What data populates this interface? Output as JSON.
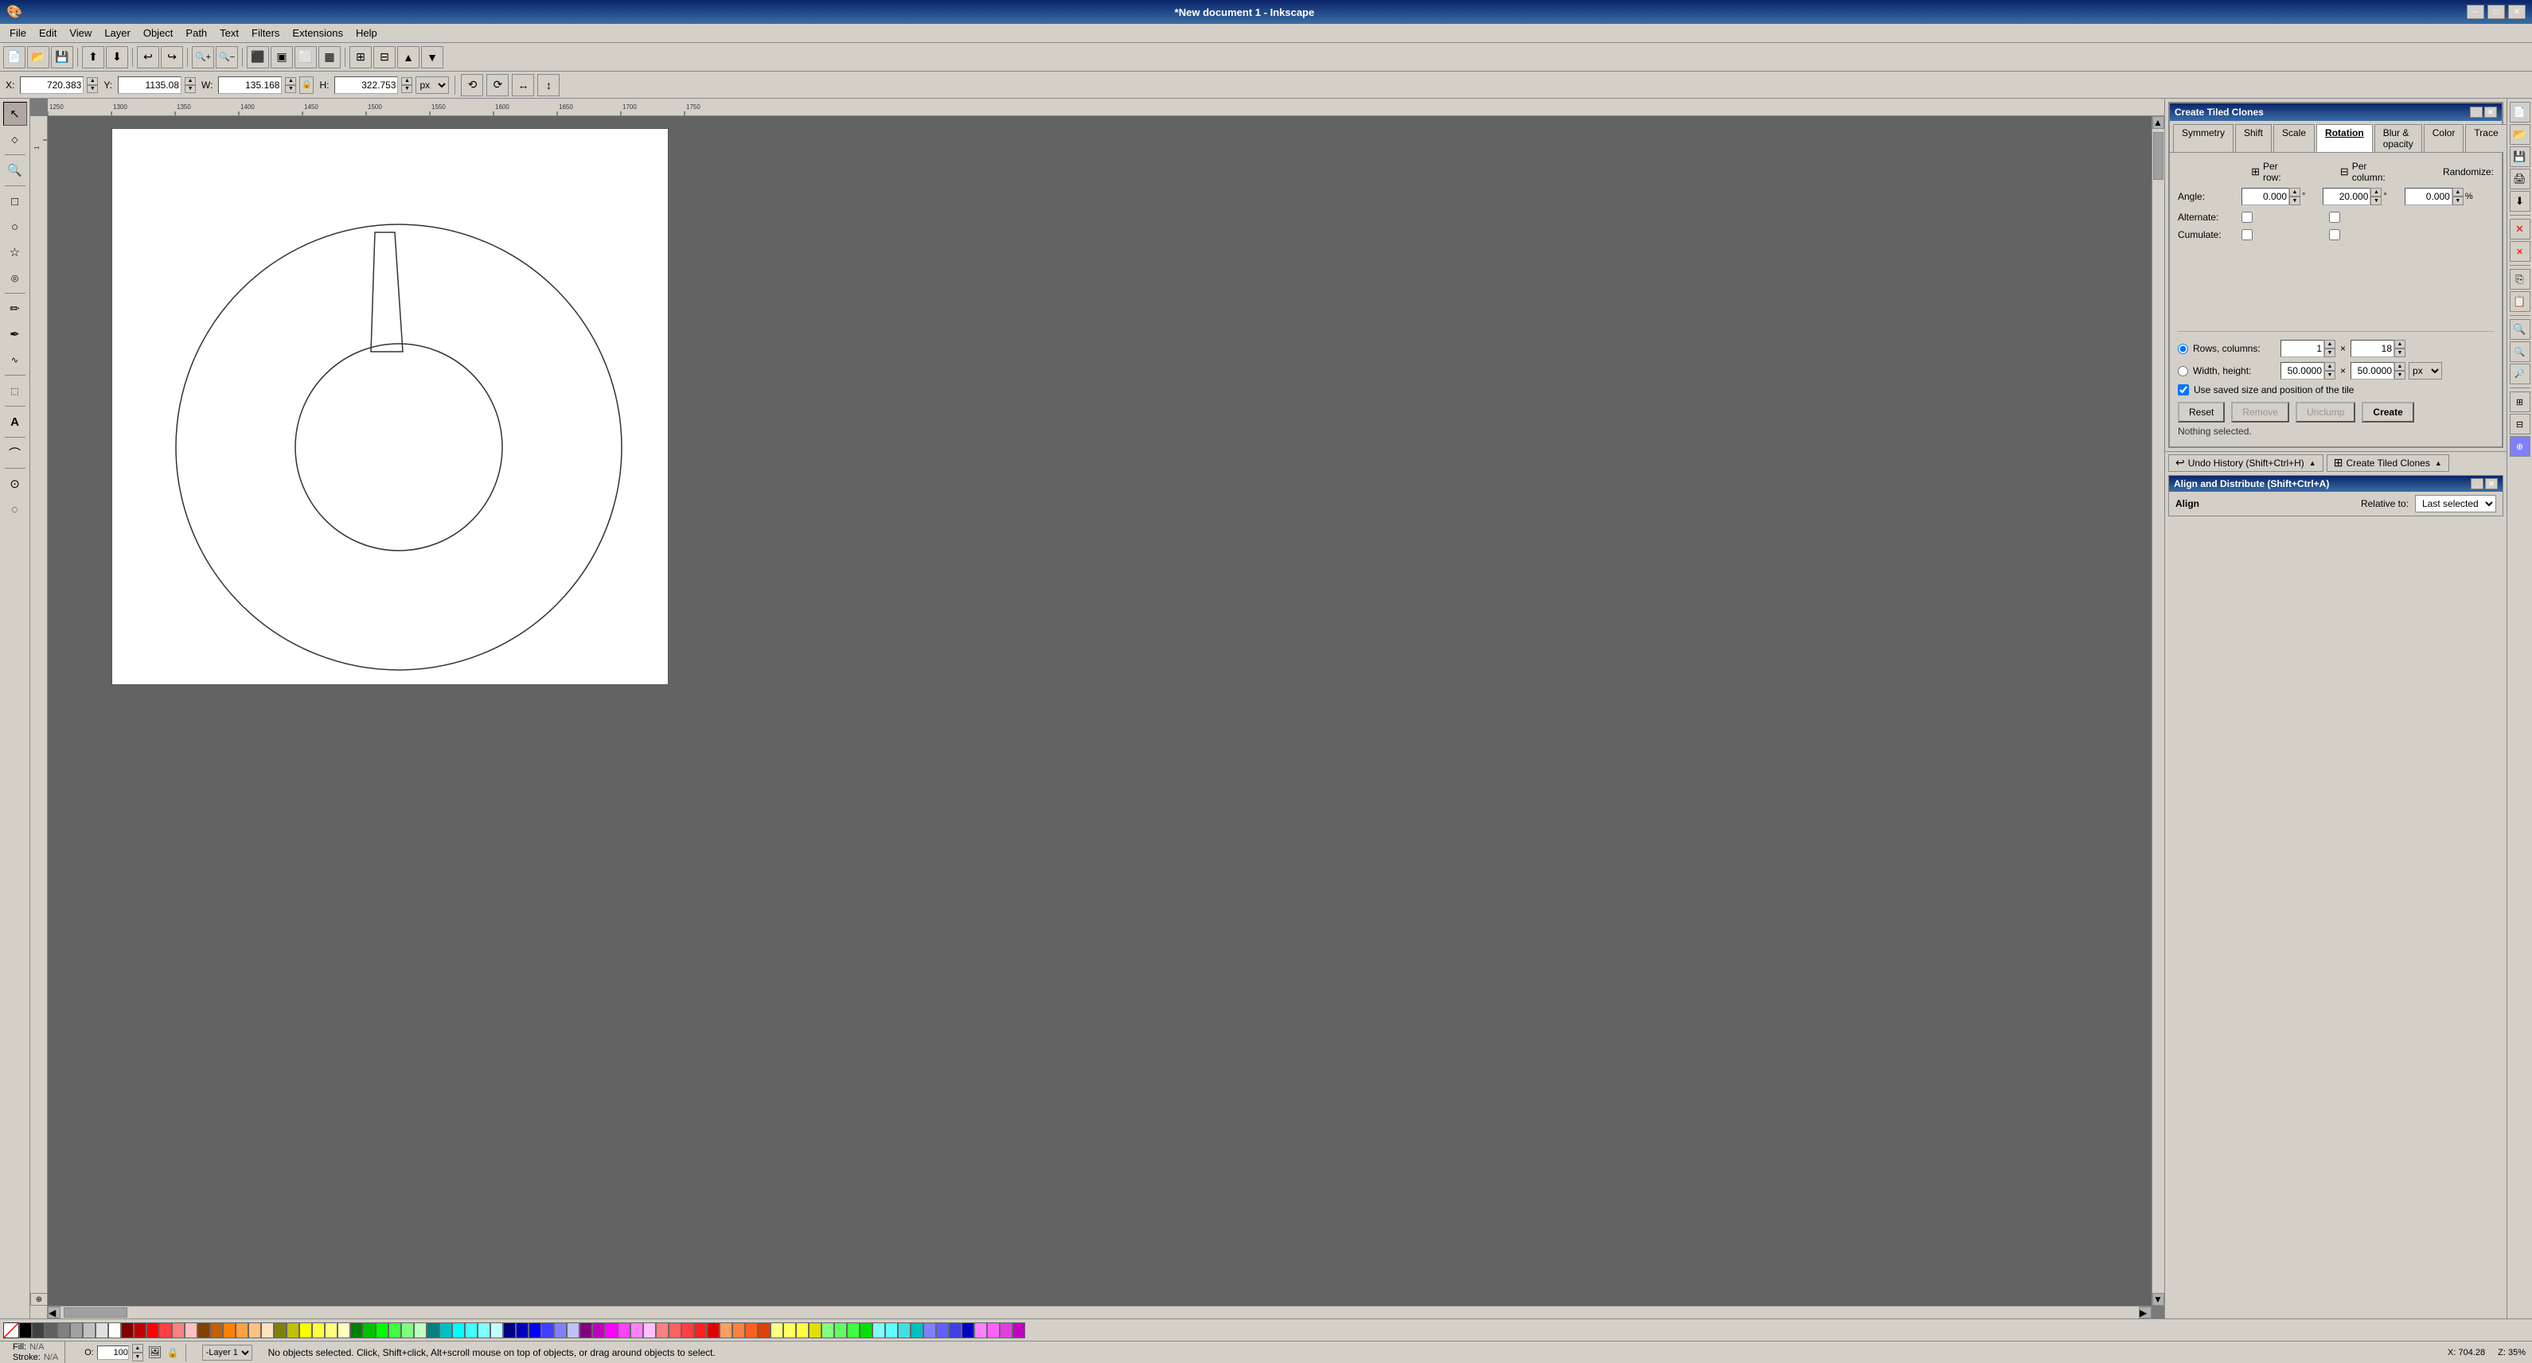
{
  "titlebar": {
    "title": "*New document 1 - Inkscape",
    "minimize": "─",
    "maximize": "□",
    "close": "✕"
  },
  "menu": {
    "items": [
      "File",
      "Edit",
      "View",
      "Layer",
      "Object",
      "Path",
      "Text",
      "Filters",
      "Extensions",
      "Help"
    ]
  },
  "toolbar": {
    "buttons": [
      "new",
      "open",
      "save",
      "print",
      "import",
      "export",
      "undo",
      "redo",
      "zoom-in",
      "zoom-out"
    ]
  },
  "coordbar": {
    "x_label": "X:",
    "x_value": "720.383",
    "y_label": "Y:",
    "y_value": "1135.08",
    "w_label": "W:",
    "w_value": "135.168",
    "h_label": "H:",
    "h_value": "322.753",
    "unit": "px",
    "lock": "🔒"
  },
  "left_tools": {
    "tools": [
      {
        "name": "select",
        "icon": "↖",
        "label": "Select tool"
      },
      {
        "name": "node",
        "icon": "◇",
        "label": "Node tool"
      },
      {
        "name": "zoom",
        "icon": "🔍",
        "label": "Zoom tool"
      },
      {
        "name": "rect",
        "icon": "□",
        "label": "Rectangle tool"
      },
      {
        "name": "ellipse",
        "icon": "○",
        "label": "Ellipse tool"
      },
      {
        "name": "star",
        "icon": "☆",
        "label": "Star tool"
      },
      {
        "name": "spiral",
        "icon": "◎",
        "label": "Spiral tool"
      },
      {
        "name": "pencil",
        "icon": "✏",
        "label": "Pencil tool"
      },
      {
        "name": "pen",
        "icon": "✒",
        "label": "Pen tool"
      },
      {
        "name": "calligraphy",
        "icon": "∿",
        "label": "Calligraphy tool"
      },
      {
        "name": "paint-bucket",
        "icon": "⬚",
        "label": "Paint bucket"
      },
      {
        "name": "text",
        "icon": "A",
        "label": "Text tool"
      },
      {
        "name": "connector",
        "icon": "⌒",
        "label": "Connector tool"
      },
      {
        "name": "dropper",
        "icon": "⊙",
        "label": "Dropper tool"
      },
      {
        "name": "spray",
        "icon": "◌",
        "label": "Spray tool"
      }
    ]
  },
  "tiled_clones": {
    "title": "Create Tiled Clones",
    "tabs": [
      "Symmetry",
      "Shift",
      "Scale",
      "Rotation",
      "Blur & opacity",
      "Color",
      "Trace"
    ],
    "active_tab": "Rotation",
    "headers": {
      "per_row": "Per row:",
      "per_column": "Per column:",
      "randomize": "Randomize:"
    },
    "angle_label": "Angle:",
    "angle_per_row": "0.000",
    "angle_per_col": "20.000",
    "angle_random": "0.000",
    "degree_sym": "°",
    "percent_sym": "%",
    "alternate_label": "Alternate:",
    "cumulate_label": "Cumulate:",
    "rows_cols_label": "Rows, columns:",
    "rows_value": "1",
    "cols_value": "18",
    "width_height_label": "Width, height:",
    "width_value": "50.0000",
    "height_value": "50.0000",
    "unit": "px",
    "use_saved_label": "Use saved size and position of the tile",
    "buttons": {
      "reset": "Reset",
      "remove": "Remove",
      "unclump": "Unclump",
      "create": "Create"
    },
    "status": "Nothing selected."
  },
  "dock": {
    "undo_history": "Undo History (Shift+Ctrl+H)",
    "create_tiled_clones": "Create Tiled Clones"
  },
  "align": {
    "title": "Align and Distribute (Shift+Ctrl+A)",
    "label": "Align",
    "relative_to_label": "Relative to:",
    "relative_to_value": "Last selected"
  },
  "status_bar": {
    "fill_label": "Fill:",
    "fill_value": "N/A",
    "stroke_label": "Stroke:",
    "stroke_value": "N/A",
    "opacity_label": "O:",
    "opacity_value": "100",
    "layer_label": "-Layer 1",
    "message": "No objects selected. Click, Shift+click, Alt+scroll mouse on top of objects, or drag around objects to select.",
    "coords": "X: 704.28",
    "zoom": "Z: 35%"
  },
  "palette_colors": [
    "#000000",
    "#404040",
    "#606060",
    "#808080",
    "#a0a0a0",
    "#c0c0c0",
    "#e0e0e0",
    "#ffffff",
    "#800000",
    "#c00000",
    "#ff0000",
    "#ff4040",
    "#ff8080",
    "#ffc0c0",
    "#804000",
    "#c06000",
    "#ff8000",
    "#ffa040",
    "#ffc080",
    "#ffe0c0",
    "#808000",
    "#c0c000",
    "#ffff00",
    "#ffff40",
    "#ffff80",
    "#ffffc0",
    "#008000",
    "#00c000",
    "#00ff00",
    "#40ff40",
    "#80ff80",
    "#c0ffc0",
    "#008080",
    "#00c0c0",
    "#00ffff",
    "#40ffff",
    "#80ffff",
    "#c0ffff",
    "#000080",
    "#0000c0",
    "#0000ff",
    "#4040ff",
    "#8080ff",
    "#c0c0ff",
    "#800080",
    "#c000c0",
    "#ff00ff",
    "#ff40ff",
    "#ff80ff",
    "#ffc0ff",
    "#ff8080",
    "#ff6060",
    "#ff4040",
    "#ff2020",
    "#e00000",
    "#ffa060",
    "#ff8040",
    "#ff6020",
    "#e04000",
    "#ffff80",
    "#ffff60",
    "#ffff40",
    "#e0e000",
    "#80ff80",
    "#60ff60",
    "#40ff40",
    "#00e000",
    "#80ffff",
    "#60ffff",
    "#40e0e0",
    "#00c0c0",
    "#8080ff",
    "#6060ff",
    "#4040e0",
    "#0000c0",
    "#ff80ff",
    "#ff60ff",
    "#e040e0",
    "#c000c0"
  ]
}
